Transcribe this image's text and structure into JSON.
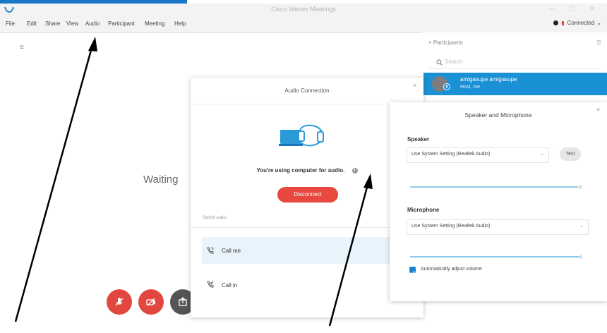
{
  "window": {
    "title": "Cisco Webex Meetings",
    "controls": [
      "–",
      "□",
      "×"
    ]
  },
  "menu": {
    "items": [
      "File",
      "Edit",
      "Share",
      "View",
      "Audio",
      "Participant",
      "Meeting",
      "Help"
    ],
    "connection_status": "Connected",
    "connection_chevron": "⌄"
  },
  "main": {
    "menu_glyph": "≡",
    "waiting_text": "Waiting"
  },
  "controls": [
    {
      "icon": "microphone-icon",
      "color": "#e2473f"
    },
    {
      "icon": "video-icon",
      "color": "#e2473f"
    },
    {
      "icon": "share-icon",
      "color": "#555555"
    }
  ],
  "participants": {
    "header": "Participants",
    "collapse_glyph": "˅",
    "menu_glyph": "☰",
    "search_placeholder": "Search",
    "items": [
      {
        "name": "amigasupe amigasupe",
        "role": "Host, me"
      }
    ]
  },
  "audio_dialog": {
    "title": "Audio Connection",
    "close_glyph": "˅",
    "status_text": "You're using computer for audio.",
    "info_glyph": "i",
    "disconnect_label": "Disconnect",
    "switch_audio_label": "Switch audio",
    "options": [
      {
        "label": "Call me",
        "icon": "phone-call-icon",
        "selected": true
      },
      {
        "label": "Call in",
        "icon": "phone-incoming-icon",
        "selected": false
      }
    ]
  },
  "speaker_mic": {
    "title": "Speaker and Microphone",
    "close_glyph": "×",
    "speaker_label": "Speaker",
    "speaker_value": "Use System Setting (Realtek Audio)",
    "test_label": "Test",
    "microphone_label": "Microphone",
    "microphone_value": "Use System Setting (Realtek Audio)",
    "auto_adjust_label": "Automatically adjust volume",
    "auto_adjust_checked": true,
    "chevron_glyph": "⌄"
  }
}
